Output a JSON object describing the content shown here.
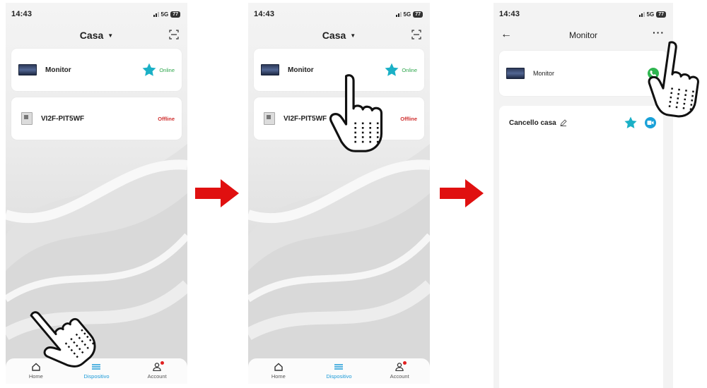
{
  "status": {
    "time": "14:43",
    "network": "5G",
    "battery": "77"
  },
  "home_screen": {
    "header_title": "Casa",
    "devices": [
      {
        "name": "Monitor",
        "state": "Online",
        "favorite": true
      },
      {
        "name": "VI2F-PIT5WF",
        "state": "Offline",
        "favorite": false
      }
    ],
    "nav": [
      {
        "label": "Home",
        "icon": "home-icon"
      },
      {
        "label": "Dispositivo",
        "icon": "devices-icon",
        "active": true
      },
      {
        "label": "Account",
        "icon": "account-icon",
        "badge": true
      }
    ]
  },
  "detail_screen": {
    "title": "Monitor",
    "device_name": "Monitor",
    "gate_name": "Cancello casa"
  },
  "colors": {
    "accent": "#1d9bd8",
    "star": "#1ab0c6",
    "online": "#2ea64c",
    "offline": "#d03030",
    "arrow": "#e01010",
    "call_green": "#2fb550"
  }
}
